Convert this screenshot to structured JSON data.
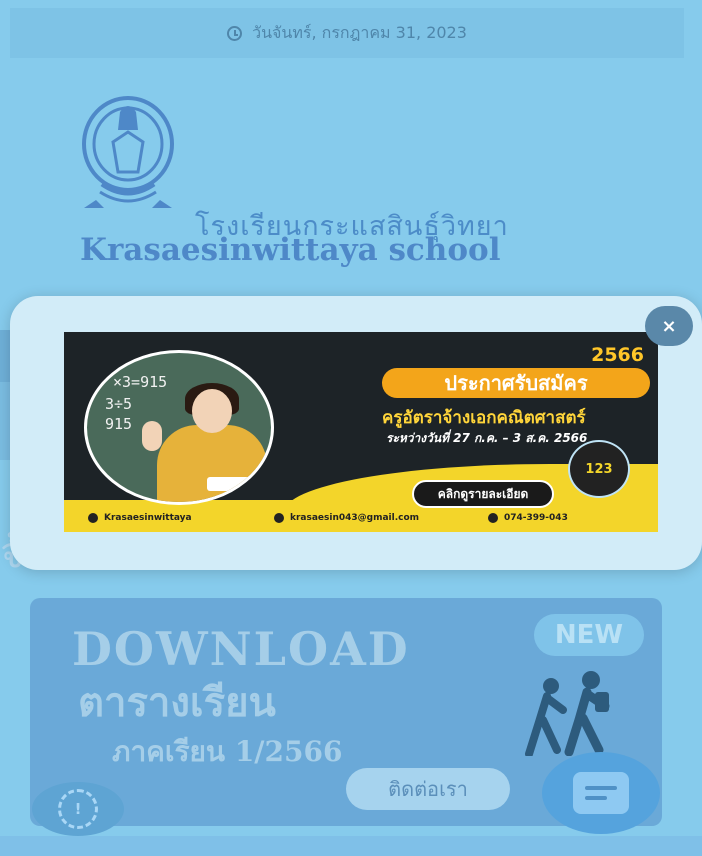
{
  "header": {
    "date": "วันจันทร์, กรกฎาคม 31, 2023",
    "icon": "clock-icon"
  },
  "school": {
    "name_th": "โรงเรียนกระแสสินธุ์วิทยา",
    "name_en": "Krasaesinwittaya school"
  },
  "background": {
    "banner_text": "จ้างวันที่ 27 ก.ค. – 3 ส.ค. 256"
  },
  "popup": {
    "close_label": "×",
    "ad": {
      "year": "2566",
      "title": "ประกาศรับสมัคร",
      "subtitle": "ครูอัตราจ้างเอกคณิตศาสตร์",
      "date_range": "ระหว่างวันที่ 27 ก.ค. – 3 ส.ค. 2566",
      "cta": "คลิกดูรายละเอียด",
      "board_lines": [
        "×3=915",
        "3÷5",
        "915"
      ],
      "contacts": [
        {
          "icon": "location-icon",
          "text": "Krasaesinwittaya"
        },
        {
          "icon": "mail-icon",
          "text": "krasaesin043@gmail.com"
        },
        {
          "icon": "phone-icon",
          "text": "074-399-043"
        }
      ],
      "geo_label": "123"
    }
  },
  "promo": {
    "download": "DOWNLOAD",
    "timetable": "ตารางเรียน",
    "term": "ภาคเรียน 1/2566",
    "new_badge": "NEW"
  },
  "widgets": {
    "contact_label": "ติดต่อเรา"
  },
  "colors": {
    "overlay": "#86cbec",
    "ad_yellow": "#f3d52a",
    "ad_orange": "#f3a51a",
    "ad_dark": "#1d2327"
  }
}
